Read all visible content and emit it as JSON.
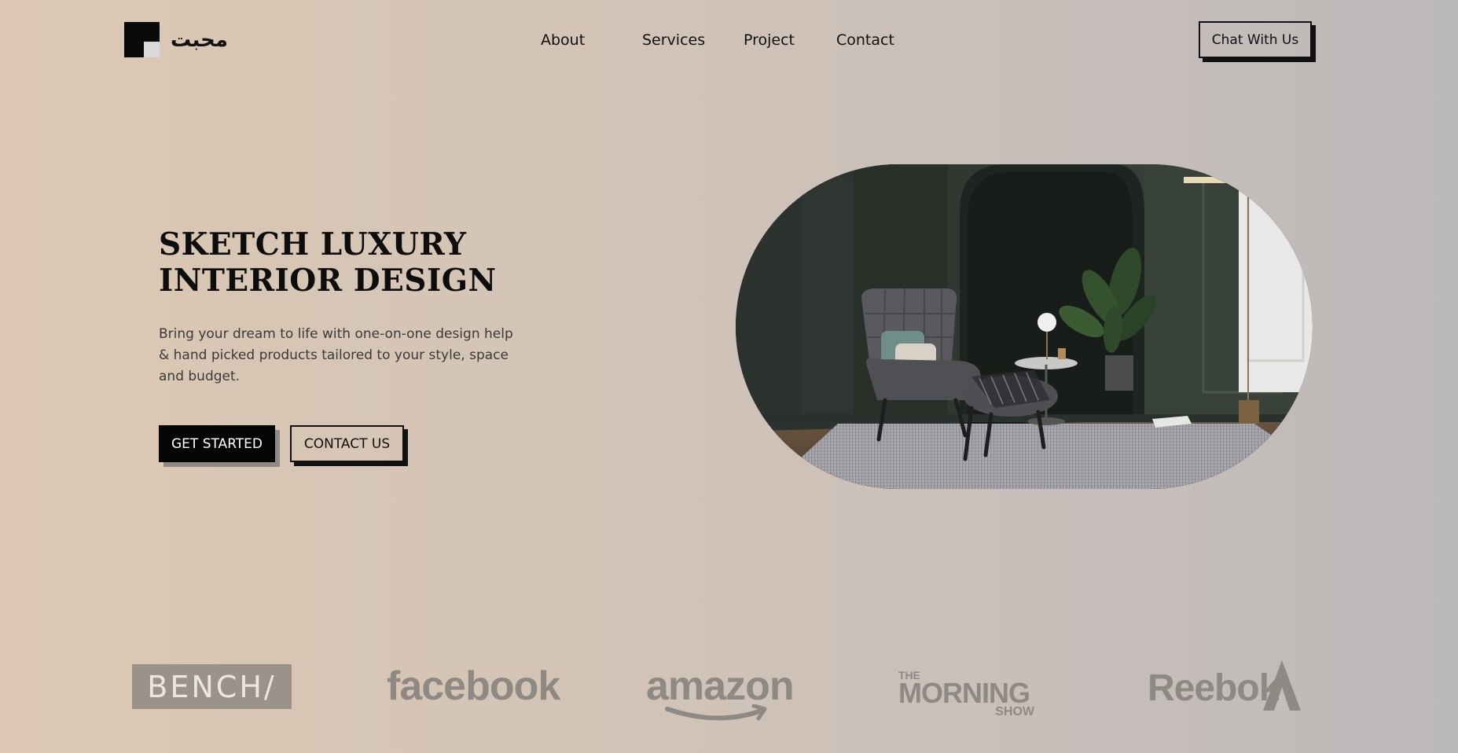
{
  "header": {
    "logo_text": "محبت",
    "nav": [
      {
        "label": "About"
      },
      {
        "label": "Services"
      },
      {
        "label": "Project"
      },
      {
        "label": "Contact"
      }
    ],
    "cta_label": "Chat With Us"
  },
  "hero": {
    "title_line1": "SKETCH LUXURY",
    "title_line2": "INTERIOR DESIGN",
    "description": "Bring your dream to life with one-on-one design help & hand picked products tailored to your style, space and budget.",
    "primary_button": "GET STARTED",
    "secondary_button": "CONTACT US",
    "image_icon": "interior-photo-lounge-chair"
  },
  "brands": {
    "bench": "BENCH/",
    "facebook": "facebook",
    "amazon": "amazon",
    "morning_the": "THE",
    "morning_main": "MORNING",
    "morning_show": "SHOW",
    "reebok": "Reebok"
  },
  "colors": {
    "accent_dark": "#050505",
    "shadow_gray": "#8f8a85",
    "bg_warm": "#dcc8b3",
    "bg_cool": "#bcb9b9",
    "brand_gray": "#8f8983"
  }
}
